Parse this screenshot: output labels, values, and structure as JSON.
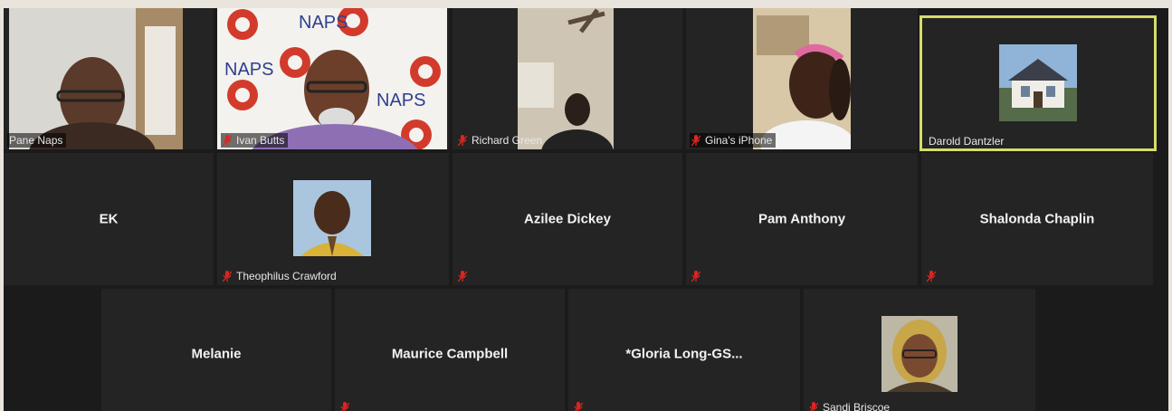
{
  "participants": [
    {
      "name": "Pane Naps",
      "muted": false
    },
    {
      "name": "Ivan Butts",
      "muted": true,
      "background_text": "NAPS"
    },
    {
      "name": "Richard Green",
      "muted": true
    },
    {
      "name": "Gina's iPhone",
      "muted": true
    },
    {
      "name": "Darold Dantzler",
      "muted": false,
      "active_speaker": true
    },
    {
      "name": "EK"
    },
    {
      "name": "Theophilus Crawford",
      "muted": true
    },
    {
      "name": "Azilee Dickey",
      "muted": true
    },
    {
      "name": "Pam Anthony",
      "muted": true
    },
    {
      "name": "Shalonda Chaplin",
      "muted": true
    },
    {
      "name": "Melanie"
    },
    {
      "name": "Maurice Campbell",
      "muted": true
    },
    {
      "name": "*Gloria  Long-GS...",
      "muted": true
    },
    {
      "name": "Sandi Briscoe",
      "muted": true
    }
  ],
  "colors": {
    "active_speaker_border": "#d5dc6a",
    "muted_icon": "#e0241f",
    "tile_bg": "#242424",
    "grid_bg": "#1b1b1b"
  },
  "icons": {
    "muted": "muted-microphone-icon"
  }
}
